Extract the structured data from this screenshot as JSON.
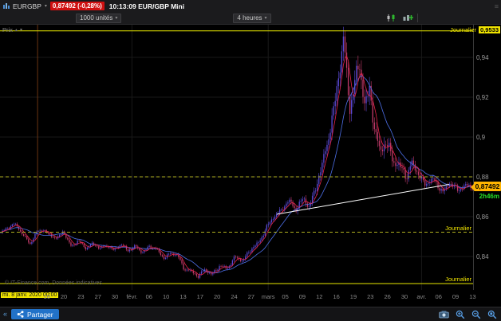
{
  "top_bar": {
    "instrument": "EURGBP",
    "price_badge": "0,87492 (-0,28%)",
    "session_info": "10:13:09 EUR/GBP Mini"
  },
  "toolbar": {
    "quantity": "1000 unités",
    "timeframe": "4 heures"
  },
  "chart": {
    "panel_label": "Prix",
    "watermark": "© IT-Finance.com, Données indicatives",
    "price_marker": {
      "label": "0,87492",
      "countdown": "2h46m"
    },
    "levels": [
      {
        "name": "journalier-high",
        "label": "Journalier",
        "value_label": "0,9533",
        "price": 0.9533,
        "style": "solid",
        "color": "#e8e800"
      },
      {
        "name": "intraday-level",
        "label": "",
        "price": 0.88,
        "style": "dashed",
        "color": "#b0b020"
      },
      {
        "name": "journalier-mid",
        "label": "Journalier",
        "price": 0.8522,
        "style": "dashed",
        "color": "#b0b020"
      },
      {
        "name": "journalier-low",
        "label": "Journalier",
        "price": 0.8264,
        "style": "solid",
        "color": "#e8e800"
      }
    ]
  },
  "chart_data": {
    "type": "candlestick",
    "instrument": "EUR/GBP Mini",
    "timeframe": "4 heures",
    "current_price": 0.87492,
    "change_pct": -0.28,
    "ylim": [
      0.8232,
      0.9564
    ],
    "y_ticks": [
      0.84,
      0.86,
      0.88,
      0.9,
      0.92,
      0.94
    ],
    "y_tick_labels": [
      "0,84",
      "0,86",
      "0,88",
      "0,9",
      "0,92",
      "0,94"
    ],
    "x_labels": [
      "mi. 8 janv. 2020 00:00",
      "16",
      "20",
      "23",
      "27",
      "30",
      "févr.",
      "06",
      "10",
      "13",
      "17",
      "20",
      "24",
      "27",
      "mars",
      "05",
      "09",
      "12",
      "16",
      "19",
      "23",
      "26",
      "30",
      "avr.",
      "06",
      "09",
      "13"
    ],
    "x_first_fraction": 0.099,
    "x_step_fraction": 0.036,
    "month_fractions": [
      0.279,
      0.567,
      0.891
    ],
    "session_marker_fraction": 0.0795,
    "price_path": [
      [
        0.0,
        0.852
      ],
      [
        0.015,
        0.8545
      ],
      [
        0.03,
        0.8565
      ],
      [
        0.045,
        0.8515
      ],
      [
        0.063,
        0.8462
      ],
      [
        0.075,
        0.852
      ],
      [
        0.089,
        0.8535
      ],
      [
        0.105,
        0.8505
      ],
      [
        0.12,
        0.849
      ],
      [
        0.132,
        0.8528
      ],
      [
        0.149,
        0.845
      ],
      [
        0.165,
        0.848
      ],
      [
        0.18,
        0.844
      ],
      [
        0.195,
        0.8465
      ],
      [
        0.21,
        0.8442
      ],
      [
        0.225,
        0.8455
      ],
      [
        0.24,
        0.8432
      ],
      [
        0.255,
        0.8462
      ],
      [
        0.27,
        0.8428
      ],
      [
        0.285,
        0.8452
      ],
      [
        0.3,
        0.842
      ],
      [
        0.315,
        0.845
      ],
      [
        0.33,
        0.8438
      ],
      [
        0.345,
        0.8392
      ],
      [
        0.36,
        0.8415
      ],
      [
        0.375,
        0.8408
      ],
      [
        0.388,
        0.8338
      ],
      [
        0.402,
        0.8328
      ],
      [
        0.419,
        0.83
      ],
      [
        0.432,
        0.8335
      ],
      [
        0.448,
        0.8308
      ],
      [
        0.465,
        0.8355
      ],
      [
        0.48,
        0.8338
      ],
      [
        0.497,
        0.8398
      ],
      [
        0.513,
        0.8378
      ],
      [
        0.53,
        0.8435
      ],
      [
        0.548,
        0.8472
      ],
      [
        0.565,
        0.8552
      ],
      [
        0.58,
        0.8602
      ],
      [
        0.595,
        0.8632
      ],
      [
        0.611,
        0.8682
      ],
      [
        0.626,
        0.8635
      ],
      [
        0.641,
        0.8692
      ],
      [
        0.655,
        0.8648
      ],
      [
        0.67,
        0.8762
      ],
      [
        0.685,
        0.8892
      ],
      [
        0.7,
        0.9052
      ],
      [
        0.713,
        0.924
      ],
      [
        0.7265,
        0.9495
      ],
      [
        0.7335,
        0.932
      ],
      [
        0.741,
        0.913
      ],
      [
        0.75,
        0.928
      ],
      [
        0.762,
        0.936
      ],
      [
        0.772,
        0.915
      ],
      [
        0.782,
        0.924
      ],
      [
        0.793,
        0.904
      ],
      [
        0.803,
        0.893
      ],
      [
        0.818,
        0.8975
      ],
      [
        0.832,
        0.8882
      ],
      [
        0.846,
        0.8852
      ],
      [
        0.862,
        0.8802
      ],
      [
        0.872,
        0.8872
      ],
      [
        0.884,
        0.8822
      ],
      [
        0.898,
        0.8762
      ],
      [
        0.917,
        0.8788
      ],
      [
        0.938,
        0.8722
      ],
      [
        0.952,
        0.8772
      ],
      [
        0.97,
        0.8732
      ],
      [
        0.985,
        0.8758
      ],
      [
        1.0,
        0.87492
      ]
    ],
    "volatility": [
      [
        0.0,
        0.0008
      ],
      [
        0.35,
        0.0009
      ],
      [
        0.5,
        0.0011
      ],
      [
        0.6,
        0.0014
      ],
      [
        0.65,
        0.0019
      ],
      [
        0.69,
        0.003
      ],
      [
        0.72,
        0.0052
      ],
      [
        0.76,
        0.0055
      ],
      [
        0.8,
        0.0042
      ],
      [
        0.85,
        0.003
      ],
      [
        0.9,
        0.002
      ],
      [
        1.0,
        0.0015
      ]
    ],
    "trendline": {
      "x1": 0.585,
      "price1": 0.8612,
      "x2": 0.949,
      "price2": 0.8762,
      "color": "#ffffff"
    },
    "colors": {
      "up": "#5a4ad6",
      "down": "#c23a6a",
      "ma_fast": "#e8234a",
      "ma_slow": "#4d6fe8"
    }
  },
  "status_bar": {
    "share_label": "Partager"
  }
}
